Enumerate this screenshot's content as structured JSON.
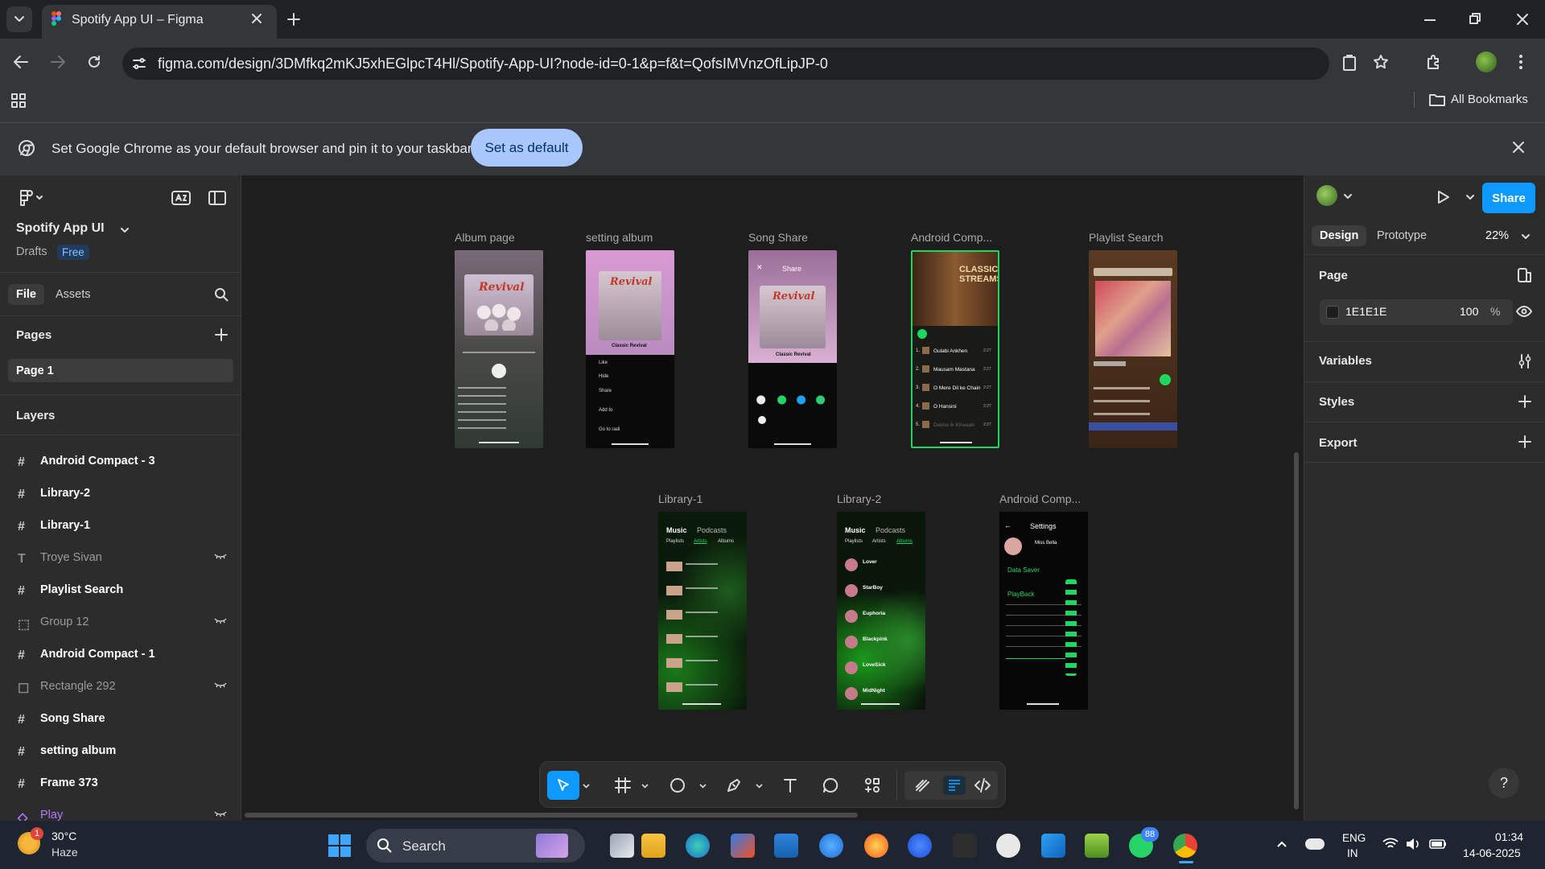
{
  "browser": {
    "tab_title": "Spotify App UI – Figma",
    "url": "figma.com/design/3DMfkq2mKJ5xhEGlpcT4Hl/Spotify-App-UI?node-id=0-1&p=f&t=QofsIMVnzOfLipJP-0",
    "bookmarks_label": "All Bookmarks",
    "infobar_text": "Set Google Chrome as your default browser and pin it to your taskbar",
    "infobar_button": "Set as default"
  },
  "left_panel": {
    "file_name": "Spotify App UI",
    "drafts": "Drafts",
    "plan_badge": "Free",
    "tab_file": "File",
    "tab_assets": "Assets",
    "pages_heading": "Pages",
    "current_page": "Page 1",
    "layers_heading": "Layers",
    "layers": [
      {
        "name": "Android Compact - 3",
        "icon": "frame-icon",
        "hidden": false
      },
      {
        "name": "Library-2",
        "icon": "frame-icon",
        "hidden": false
      },
      {
        "name": "Library-1",
        "icon": "frame-icon",
        "hidden": false
      },
      {
        "name": "Troye Sivan",
        "icon": "text-icon",
        "hidden": true
      },
      {
        "name": "Playlist Search",
        "icon": "frame-icon",
        "hidden": false
      },
      {
        "name": "Group 12",
        "icon": "group-icon",
        "hidden": true
      },
      {
        "name": "Android Compact - 1",
        "icon": "frame-icon",
        "hidden": false
      },
      {
        "name": "Rectangle 292",
        "icon": "rectangle-icon",
        "hidden": true
      },
      {
        "name": "Song Share",
        "icon": "frame-icon",
        "hidden": false
      },
      {
        "name": "setting album",
        "icon": "frame-icon",
        "hidden": false
      },
      {
        "name": "Frame 373",
        "icon": "frame-icon",
        "hidden": false
      },
      {
        "name": "Play",
        "icon": "component-icon",
        "hidden": true
      }
    ]
  },
  "canvas": {
    "frames": [
      {
        "label": "Album page"
      },
      {
        "label": "setting album"
      },
      {
        "label": "Song Share"
      },
      {
        "label": "Android Comp..."
      },
      {
        "label": "Playlist Search"
      },
      {
        "label": "Library-1"
      },
      {
        "label": "Library-2"
      },
      {
        "label": "Android Comp..."
      }
    ]
  },
  "mock_texts": {
    "album_title": "Revival",
    "album_sub": "Classic Revival",
    "song_share_header": "Share",
    "classic_streams": "CLASSIC STREAMS",
    "songs": [
      "Gulabi Ankhen",
      "Mausam Mastana",
      "O Mere Dil ke Chain",
      "O Hansini",
      "Dekha Ik Khwaab"
    ],
    "song_time": "2:27",
    "settings_title": "Settings",
    "settings_user": "Miss Bella",
    "data_saver": "Data Saver",
    "playback": "PlayBack",
    "lib_music": "Music",
    "lib_podcasts": "Podcasts",
    "lib_tabs": [
      "Playlists",
      "Artists",
      "Albums"
    ],
    "lib2_items": [
      "Lover",
      "StarBoy",
      "Euphoria",
      "Blackpink",
      "LoveSick",
      "MidNight"
    ],
    "setting_menu": [
      "Like",
      "Hide",
      "Share",
      "Add to",
      "Go to radi"
    ]
  },
  "right_panel": {
    "tab_design": "Design",
    "tab_prototype": "Prototype",
    "zoom": "22%",
    "share_button": "Share",
    "page_heading": "Page",
    "page_color": "1E1E1E",
    "page_opacity": "100",
    "opacity_unit": "%",
    "variables": "Variables",
    "styles": "Styles",
    "export": "Export",
    "help": "?"
  },
  "taskbar": {
    "weather_temp": "30°C",
    "weather_desc": "Haze",
    "weather_badge": "1",
    "search_label": "Search",
    "whatsapp_badge": "88",
    "lang_1": "ENG",
    "lang_2": "IN",
    "time": "01:34",
    "date": "14-06-2025"
  },
  "colors": {
    "canvas_bg": "#1e1e1e",
    "panel_bg": "#2c2c2c",
    "accent_blue": "#0d99ff",
    "selected_frame": "#1ed760"
  }
}
